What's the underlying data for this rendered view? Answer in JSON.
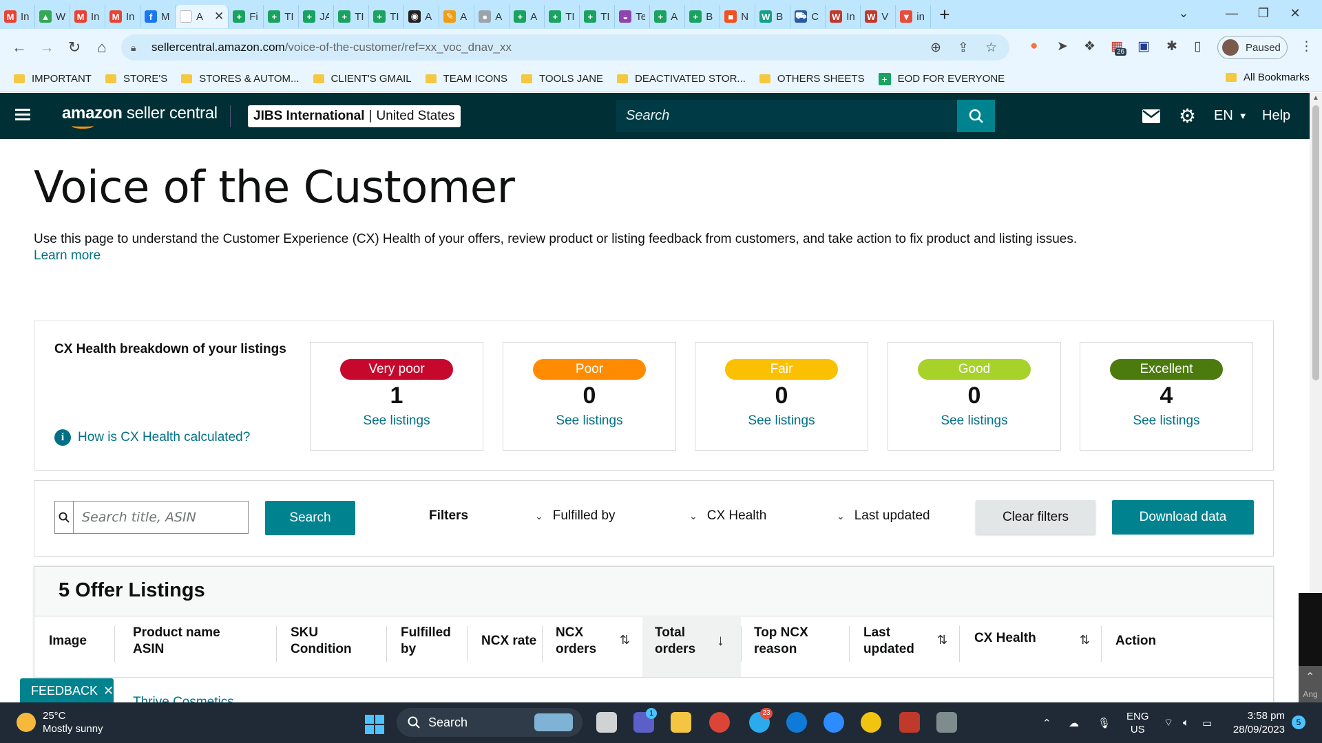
{
  "browser": {
    "tabs": [
      {
        "label": "In",
        "icon": "gmail-icon",
        "color": "#ea4335",
        "glyph": "M"
      },
      {
        "label": "W",
        "icon": "drive-icon",
        "color": "#34a853",
        "glyph": "▲"
      },
      {
        "label": "In",
        "icon": "gmail-icon",
        "color": "#ea4335",
        "glyph": "M"
      },
      {
        "label": "In",
        "icon": "gmail-icon",
        "color": "#ea4335",
        "glyph": "M"
      },
      {
        "label": "M",
        "icon": "facebook-icon",
        "color": "#1877f2",
        "glyph": "f"
      },
      {
        "label": "A",
        "icon": "amazon-icon",
        "color": "#ffffff",
        "glyph": "",
        "active": true
      },
      {
        "label": "Fi",
        "icon": "sheets-icon",
        "color": "#1aa260",
        "glyph": "+"
      },
      {
        "label": "TI",
        "icon": "sheets-icon",
        "color": "#1aa260",
        "glyph": "+"
      },
      {
        "label": "JA",
        "icon": "sheets-icon",
        "color": "#1aa260",
        "glyph": "+"
      },
      {
        "label": "TI",
        "icon": "sheets-icon",
        "color": "#1aa260",
        "glyph": "+"
      },
      {
        "label": "TI",
        "icon": "sheets-icon",
        "color": "#1aa260",
        "glyph": "+"
      },
      {
        "label": "A",
        "icon": "chatgpt-icon",
        "color": "#222222",
        "glyph": "◉"
      },
      {
        "label": "A",
        "icon": "pencil-icon",
        "color": "#f39c12",
        "glyph": "✎"
      },
      {
        "label": "A",
        "icon": "globe-icon",
        "color": "#9aa4ad",
        "glyph": "●"
      },
      {
        "label": "A",
        "icon": "sheets-icon",
        "color": "#1aa260",
        "glyph": "+"
      },
      {
        "label": "TI",
        "icon": "sheets-icon",
        "color": "#1aa260",
        "glyph": "+"
      },
      {
        "label": "TI",
        "icon": "sheets-icon",
        "color": "#1aa260",
        "glyph": "+"
      },
      {
        "label": "Te",
        "icon": "messenger-icon",
        "color": "#8e44ad",
        "glyph": "◒"
      },
      {
        "label": "A",
        "icon": "sheets-icon",
        "color": "#1aa260",
        "glyph": "+"
      },
      {
        "label": "B",
        "icon": "sheets-icon",
        "color": "#1aa260",
        "glyph": "+"
      },
      {
        "label": "N",
        "icon": "microsoft-icon",
        "color": "#f25022",
        "glyph": "■"
      },
      {
        "label": "B",
        "icon": "wiki-icon",
        "color": "#16a085",
        "glyph": "W"
      },
      {
        "label": "C",
        "icon": "car-icon",
        "color": "#2c5aa0",
        "glyph": "⛟"
      },
      {
        "label": "In",
        "icon": "wps-icon",
        "color": "#c0392b",
        "glyph": "W"
      },
      {
        "label": "V",
        "icon": "wps-icon",
        "color": "#c0392b",
        "glyph": "W"
      },
      {
        "label": "in",
        "icon": "vivaldi-icon",
        "color": "#e74c3c",
        "glyph": "▼"
      }
    ],
    "url_host": "sellercentral.amazon.com",
    "url_path": "/voice-of-the-customer/ref=xx_voc_dnav_xx",
    "profile_status": "Paused",
    "extension_badge": "26",
    "bookmarks": [
      {
        "label": "IMPORTANT",
        "type": "folder"
      },
      {
        "label": "STORE'S",
        "type": "folder"
      },
      {
        "label": "STORES & AUTOM...",
        "type": "folder"
      },
      {
        "label": "CLIENT'S GMAIL",
        "type": "folder"
      },
      {
        "label": "TEAM ICONS",
        "type": "folder"
      },
      {
        "label": "TOOLS JANE",
        "type": "folder"
      },
      {
        "label": "DEACTIVATED STOR...",
        "type": "folder"
      },
      {
        "label": "OTHERS SHEETS",
        "type": "folder"
      },
      {
        "label": "EOD FOR EVERYONE",
        "type": "sheet"
      }
    ],
    "all_bookmarks": "All Bookmarks"
  },
  "header": {
    "logo_bold": "amazon",
    "logo_rest": " seller central",
    "store_name": "JIBS International",
    "store_region": "United States",
    "search_placeholder": "Search",
    "language": "EN",
    "help": "Help"
  },
  "page": {
    "title": "Voice of the Customer",
    "description": "Use this page to understand the Customer Experience (CX) Health of your offers, review product or listing feedback from customers, and take action to fix product and listing issues.",
    "learn_more": "Learn more"
  },
  "cx_health": {
    "title": "CX Health breakdown of your listings",
    "how_link": "How is CX Health calculated?",
    "cards": [
      {
        "label": "Very poor",
        "count": "1",
        "link": "See listings",
        "color": "#c7082d"
      },
      {
        "label": "Poor",
        "count": "0",
        "link": "See listings",
        "color": "#ff8c00"
      },
      {
        "label": "Fair",
        "count": "0",
        "link": "See listings",
        "color": "#fbc002"
      },
      {
        "label": "Good",
        "count": "0",
        "link": "See listings",
        "color": "#a6d22a"
      },
      {
        "label": "Excellent",
        "count": "4",
        "link": "See listings",
        "color": "#4b7b0d"
      }
    ]
  },
  "filters": {
    "search_placeholder": "Search title, ASIN",
    "search_button": "Search",
    "filters_label": "Filters",
    "fulfilled_by": "Fulfilled by",
    "cx_health": "CX Health",
    "last_updated": "Last updated",
    "clear": "Clear filters",
    "download": "Download data"
  },
  "listings": {
    "title": "5 Offer Listings",
    "columns": {
      "image": "Image",
      "product_1": "Product name",
      "product_2": "ASIN",
      "sku_1": "SKU",
      "sku_2": "Condition",
      "fulfilled_1": "Fulfilled",
      "fulfilled_2": "by",
      "ncx_rate": "NCX rate",
      "ncx_orders_1": "NCX",
      "ncx_orders_2": "orders",
      "total_1": "Total",
      "total_2": "orders",
      "top_1": "Top NCX",
      "top_2": "reason",
      "last_1": "Last",
      "last_2": "updated",
      "cx_health": "CX Health",
      "action": "Action"
    },
    "first_row_product": "Thrive Cosmetics"
  },
  "feedback": "FEEDBACK",
  "side_widget_text": "Ang",
  "taskbar": {
    "temperature": "25°C",
    "weather": "Mostly sunny",
    "search": "Search",
    "lang_1": "ENG",
    "lang_2": "US",
    "time": "3:58 pm",
    "date": "28/09/2023",
    "notifications": "5",
    "teams_badge": "1",
    "telegram_badge": "23"
  }
}
